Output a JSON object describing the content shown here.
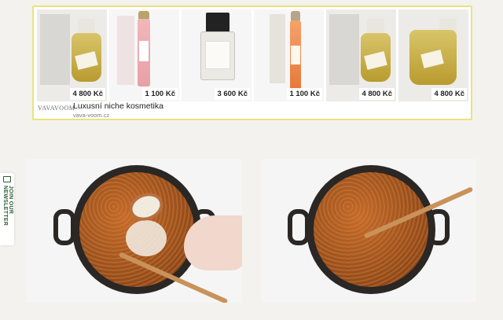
{
  "ad": {
    "products": [
      {
        "price": "4 800 Kč"
      },
      {
        "price": "1 100 Kč"
      },
      {
        "price": "3 600 Kč"
      },
      {
        "price": "1 100 Kč"
      },
      {
        "price": "4 800 Kč"
      },
      {
        "price": "4 800 Kč"
      }
    ],
    "brand": "VAVAVOOM",
    "title": "Luxusní niche kosmetika",
    "url": "vava-voom.cz",
    "choices_icon": "adchoices-icon",
    "close_icon": "close-icon"
  },
  "newsletter": {
    "label": "JOIN OUR NEWSLETTER",
    "icon": "mail-icon"
  },
  "colors": {
    "ad_border": "#ebe27d",
    "newsletter_accent": "#2f5d3a",
    "background": "#f3f2ee"
  }
}
